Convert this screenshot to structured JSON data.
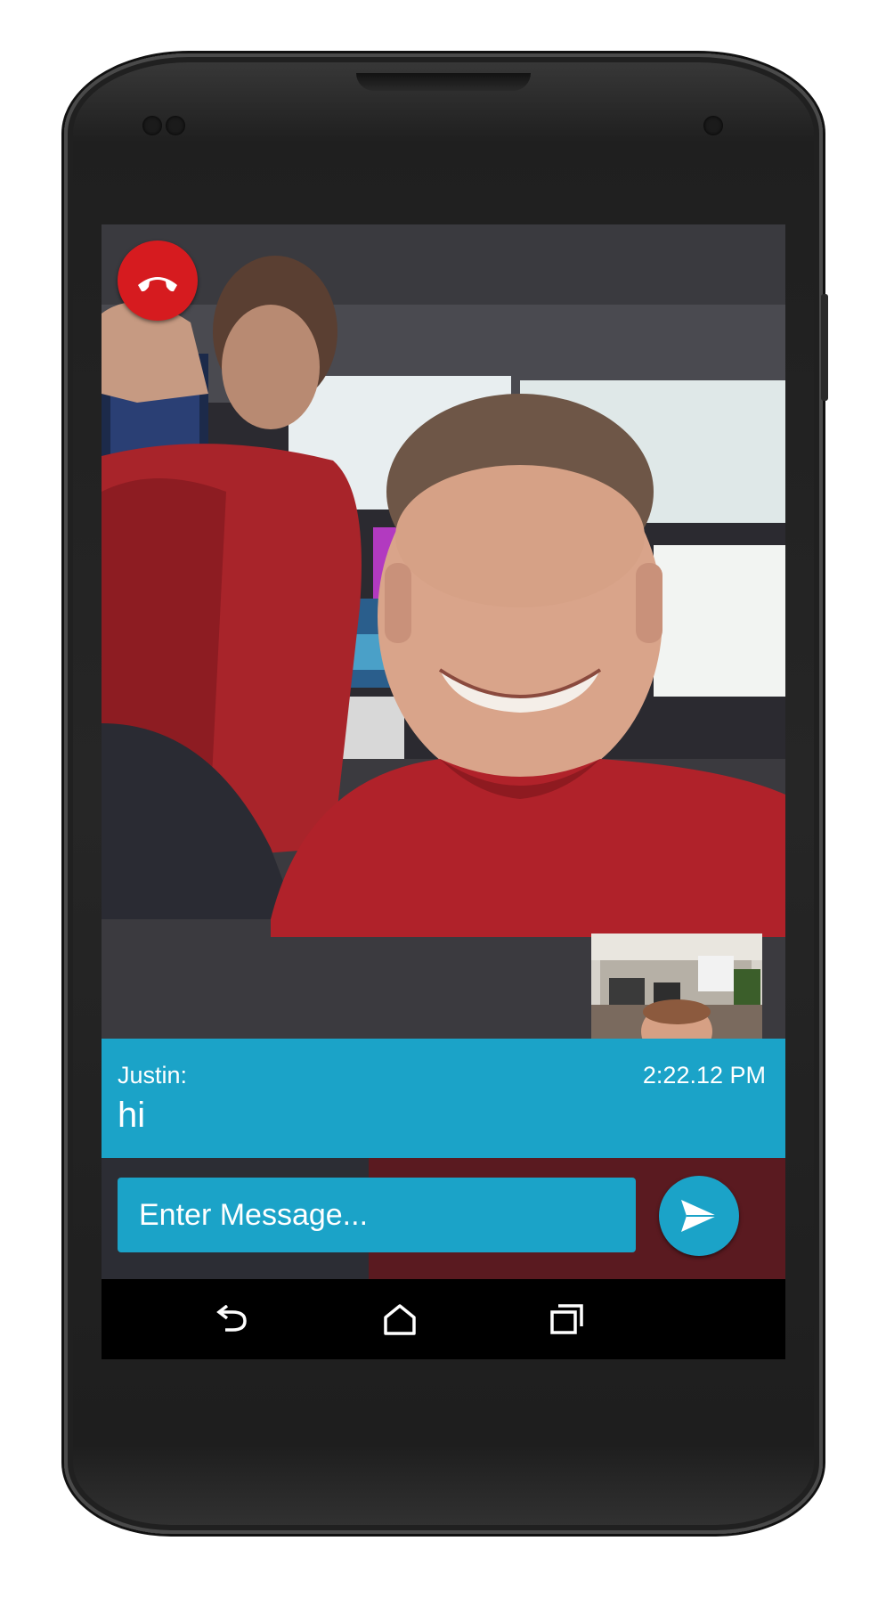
{
  "call": {
    "end_call_icon": "phone-hangup-icon",
    "end_call_color": "#d61b1f"
  },
  "message": {
    "sender": "Justin:",
    "time": "2:22.12 PM",
    "text": "hi"
  },
  "composer": {
    "placeholder": "Enter Message...",
    "send_icon": "send-icon"
  },
  "navigation": {
    "back_icon": "back-icon",
    "home_icon": "home-icon",
    "recents_icon": "recents-icon"
  },
  "colors": {
    "accent": "#1ba3c8",
    "end_call": "#d61b1f",
    "nav_bar": "#000000"
  }
}
